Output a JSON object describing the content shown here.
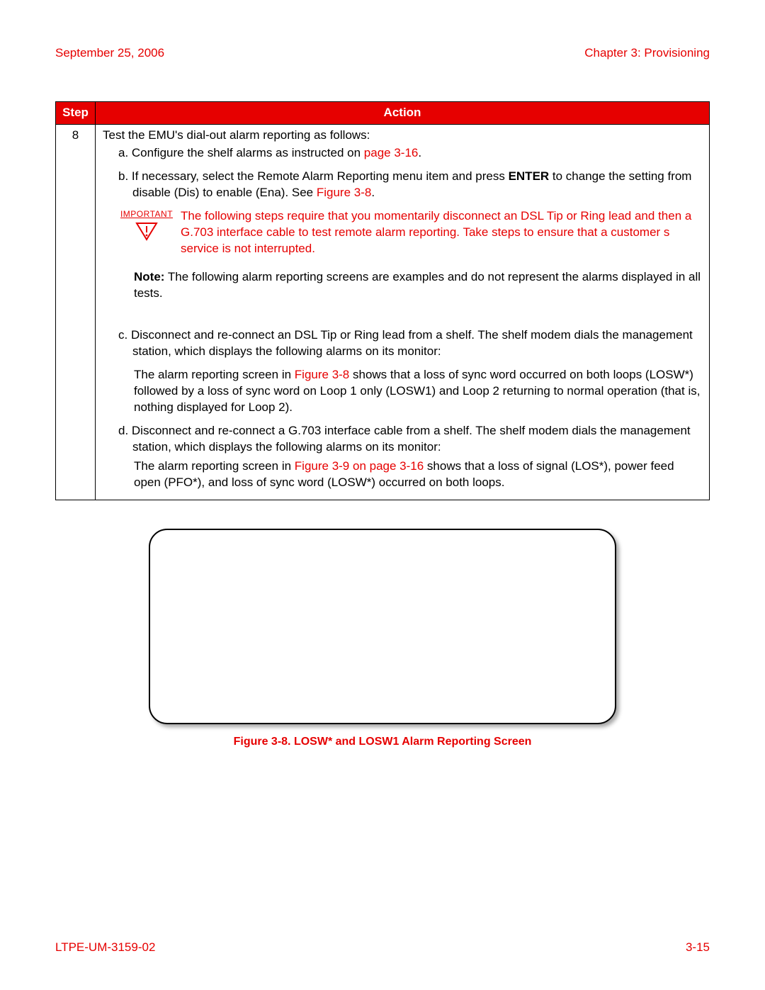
{
  "header": {
    "date": "September 25, 2006",
    "chapter": "Chapter 3: Provisioning"
  },
  "table": {
    "columns": {
      "step": "Step",
      "action": "Action"
    },
    "row": {
      "step": "8",
      "intro": "Test the EMU's dial-out alarm reporting as follows:",
      "a_prefix": "a. Configure the shelf alarms as instructed on ",
      "a_link": "page 3-16",
      "a_suffix": ".",
      "b_prefix": "b. If necessary, select the Remote Alarm Reporting menu item and press ",
      "b_bold": "ENTER",
      "b_mid": " to change the setting from disable (Dis) to enable (Ena). See ",
      "b_link": "Figure 3-8",
      "b_suffix": ".",
      "important_label": "IMPORTANT",
      "important_text": "The following steps require that you momentarily disconnect an DSL Tip or Ring lead and then a G.703 interface cable to test remote alarm reporting. Take steps to ensure that a customer s service is not interrupted.",
      "note_bold": "Note:",
      "note_text": " The following alarm reporting screens are examples and do not represent the alarms displayed in all tests.",
      "c_text": "c. Disconnect and re-connect an DSL Tip or Ring lead from a shelf. The shelf modem dials the management station, which displays the following alarms on its monitor:",
      "p1_prefix": "The alarm reporting screen in ",
      "p1_link": "Figure 3-8",
      "p1_suffix": " shows that a loss of sync word occurred on both loops (LOSW*) followed by a loss of sync word on Loop 1 only (LOSW1) and Loop 2 returning to normal operation (that is, nothing displayed for Loop 2).",
      "d_text": "d. Disconnect and re-connect a G.703 interface cable from a shelf. The shelf modem dials the management station, which displays the following alarms on its monitor:",
      "p2_prefix": "The alarm reporting screen in ",
      "p2_link": "Figure 3-9 on page 3-16",
      "p2_suffix": " shows that a loss of signal (LOS*), power feed open (PFO*), and loss of sync word (LOSW*) occurred on both loops."
    }
  },
  "figure": {
    "caption": "Figure 3-8. LOSW* and LOSW1 Alarm Reporting Screen"
  },
  "footer": {
    "doc_id": "LTPE-UM-3159-02",
    "page_num": "3-15"
  }
}
